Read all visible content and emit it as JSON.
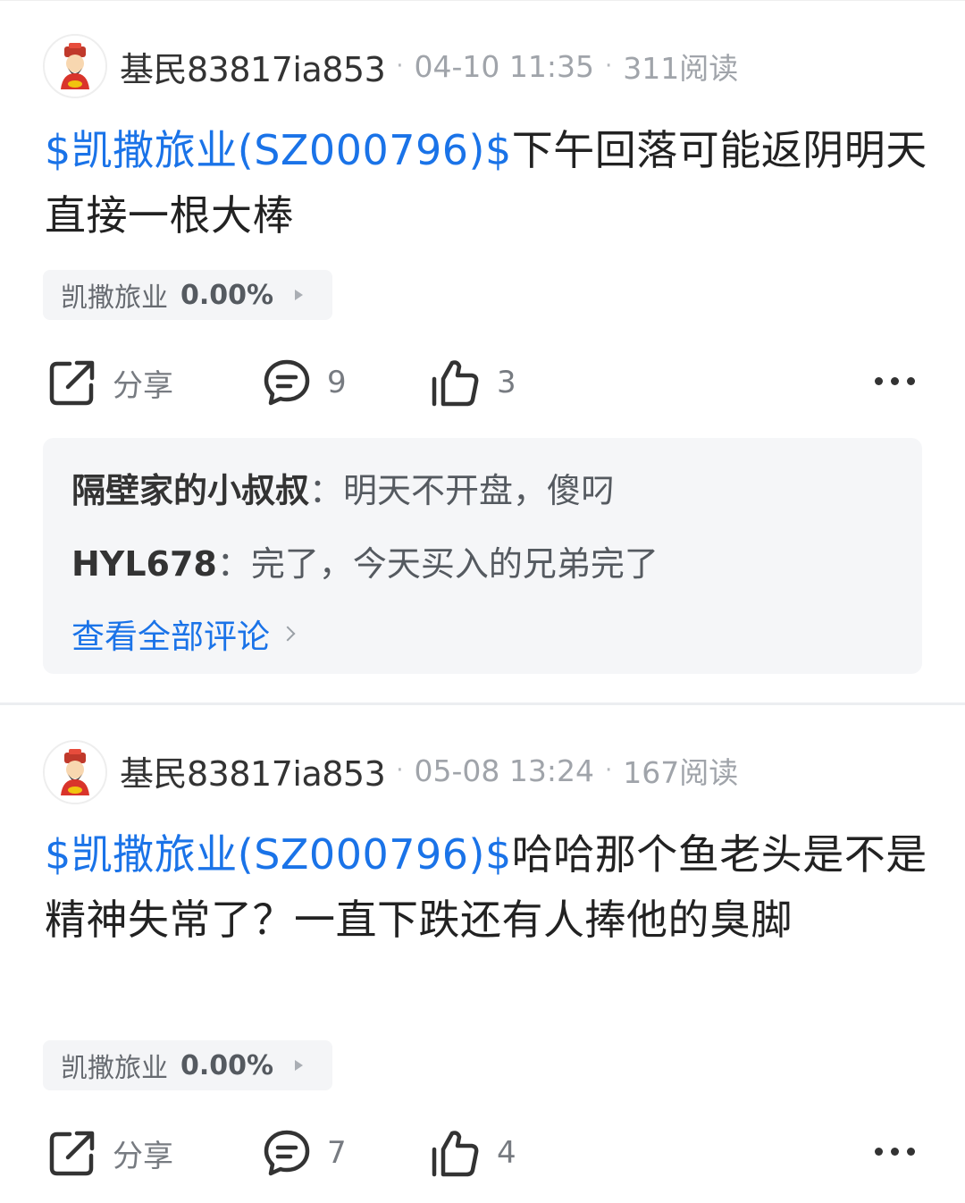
{
  "posts": [
    {
      "author": "基民83817ia853",
      "time": "04-10 11:35",
      "reads": "311阅读",
      "separator": "·",
      "stock_link": "$凯撒旅业(SZ000796)$",
      "text": "下午回落可能返阴明天直接一根大棒",
      "tag": {
        "name": "凯撒旅业",
        "change": "0.00%"
      },
      "actions": {
        "share": "分享",
        "comments": "9",
        "likes": "3"
      },
      "comment_preview": [
        {
          "user": "隔壁家的小叔叔",
          "sep": "：",
          "text": "明天不开盘，傻叼"
        },
        {
          "user": "HYL678",
          "sep": "：",
          "text": "完了，今天买入的兄弟完了"
        }
      ],
      "view_all": "查看全部评论"
    },
    {
      "author": "基民83817ia853",
      "time": "05-08 13:24",
      "reads": "167阅读",
      "separator": "·",
      "stock_link": "$凯撒旅业(SZ000796)$",
      "text": "哈哈那个鱼老头是不是精神失常了？一直下跌还有人捧他的臭脚",
      "tag": {
        "name": "凯撒旅业",
        "change": "0.00%"
      },
      "actions": {
        "share": "分享",
        "comments": "7",
        "likes": "4"
      }
    }
  ],
  "colors": {
    "link": "#1a73e8",
    "meta": "#a0a4aa",
    "panel": "#f5f6f8"
  },
  "icons": [
    "avatar-fortune-god-icon",
    "share-icon",
    "comment-icon",
    "thumbs-up-icon",
    "more-icon",
    "chevron-right-icon"
  ]
}
